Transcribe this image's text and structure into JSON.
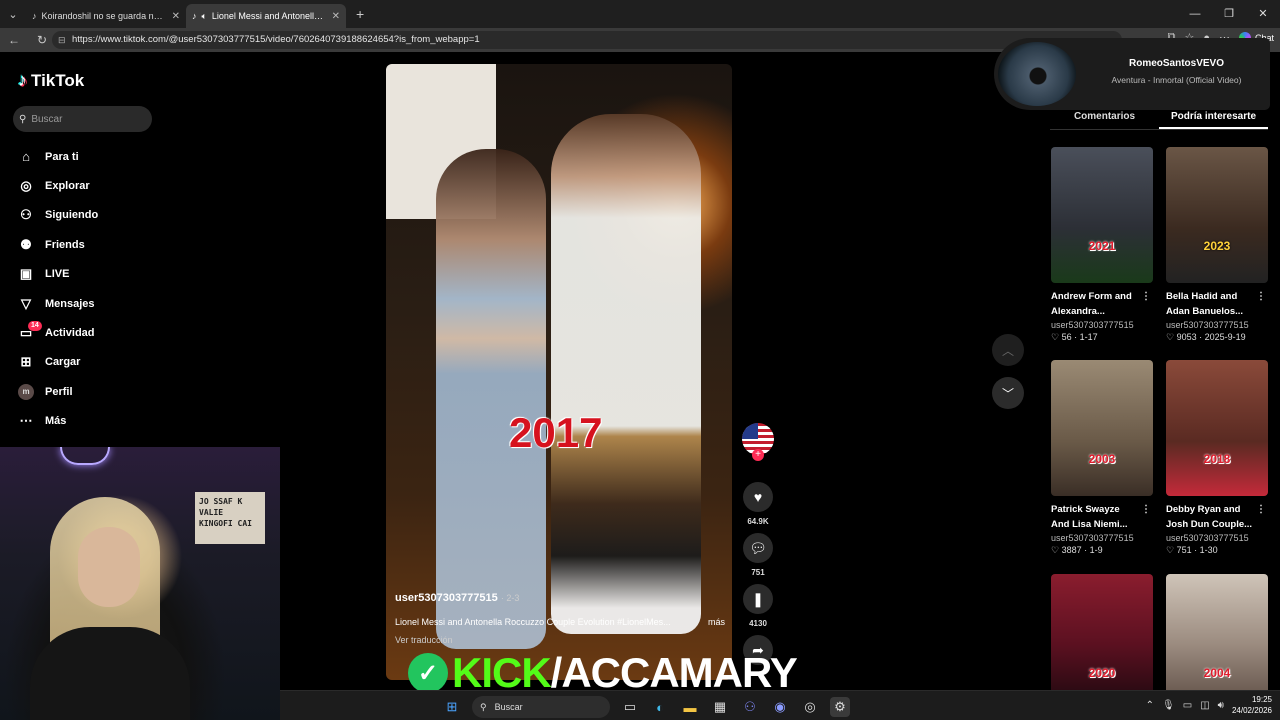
{
  "browser": {
    "tabs": [
      {
        "title": "Koirandoshil no se guarda nada. H",
        "active": false
      },
      {
        "title": "Lionel Messi and Antonella Ro",
        "active": true
      }
    ],
    "url": "https://www.tiktok.com/@user5307303777515/video/7602640739188624654?is_from_webapp=1",
    "copilot_label": "Chat"
  },
  "sidebar": {
    "logo": "TikTok",
    "search_placeholder": "Buscar",
    "items": [
      {
        "label": "Para ti",
        "icon": "home-icon"
      },
      {
        "label": "Explorar",
        "icon": "compass-icon"
      },
      {
        "label": "Siguiendo",
        "icon": "user-follow-icon"
      },
      {
        "label": "Friends",
        "icon": "friends-icon"
      },
      {
        "label": "LIVE",
        "icon": "live-tv-icon"
      },
      {
        "label": "Mensajes",
        "icon": "send-icon"
      },
      {
        "label": "Actividad",
        "icon": "activity-icon",
        "badge": "14"
      },
      {
        "label": "Cargar",
        "icon": "upload-icon"
      },
      {
        "label": "Perfil",
        "icon": "avatar-icon",
        "avatar_letter": "m"
      },
      {
        "label": "Más",
        "icon": "more-icon"
      }
    ]
  },
  "webcam": {
    "sign_text": "JO SSAF K\nVALIE\nKINGOFI CAI"
  },
  "video": {
    "year_overlay": "2017",
    "username": "user5307303777515",
    "date": "2-3",
    "description": "Lionel Messi and Antonella Roccuzzo Couple Evolution #LionelMes...",
    "more_label": "más",
    "translate_label": "Ver traducción"
  },
  "actions": {
    "likes": "64.9K",
    "comments": "751",
    "saves": "4130"
  },
  "music": {
    "artist": "RomeoSantosVEVO",
    "song": "Aventura - Inmortal (Official Video)"
  },
  "right_panel": {
    "tabs": [
      "Comentarios",
      "Podría interesarte"
    ],
    "active_tab": 1,
    "cards": [
      {
        "title1": "Andrew Form and",
        "title2": "Alexandra...",
        "user": "user5307303777515",
        "likes": "56",
        "date": "1-17",
        "year": "2021",
        "bg": "#3b3f4a"
      },
      {
        "title1": "Bella Hadid and",
        "title2": "Adan Banuelos...",
        "user": "user5307303777515",
        "likes": "9053",
        "date": "2025-9-19",
        "year": "2023",
        "bg": "#5a4636"
      },
      {
        "title1": "Patrick Swayze",
        "title2": "And Lisa Niemi...",
        "user": "user5307303777515",
        "likes": "3887",
        "date": "1-9",
        "year": "2003",
        "bg": "#7a6a58"
      },
      {
        "title1": "Debby Ryan and",
        "title2": "Josh Dun Couple...",
        "user": "user5307303777515",
        "likes": "751",
        "date": "1-30",
        "year": "2018",
        "bg": "#6b3d30"
      },
      {
        "title1": "",
        "title2": "",
        "user": "",
        "likes": "",
        "date": "",
        "year": "2020",
        "bg": "#7b1d2a"
      },
      {
        "title1": "",
        "title2": "",
        "user": "",
        "likes": "",
        "date": "",
        "year": "2004",
        "bg": "#8b7a6e"
      }
    ]
  },
  "kick_banner": {
    "left": "KICK",
    "slash": "/",
    "right": "ACCAMARY"
  },
  "taskbar": {
    "search_label": "Buscar",
    "time": "19:25",
    "date": "24/02/2026"
  },
  "colors": {
    "tiktok_red": "#fe2c55",
    "tiktok_cyan": "#25f4ee",
    "kick_green": "#53fc18"
  }
}
